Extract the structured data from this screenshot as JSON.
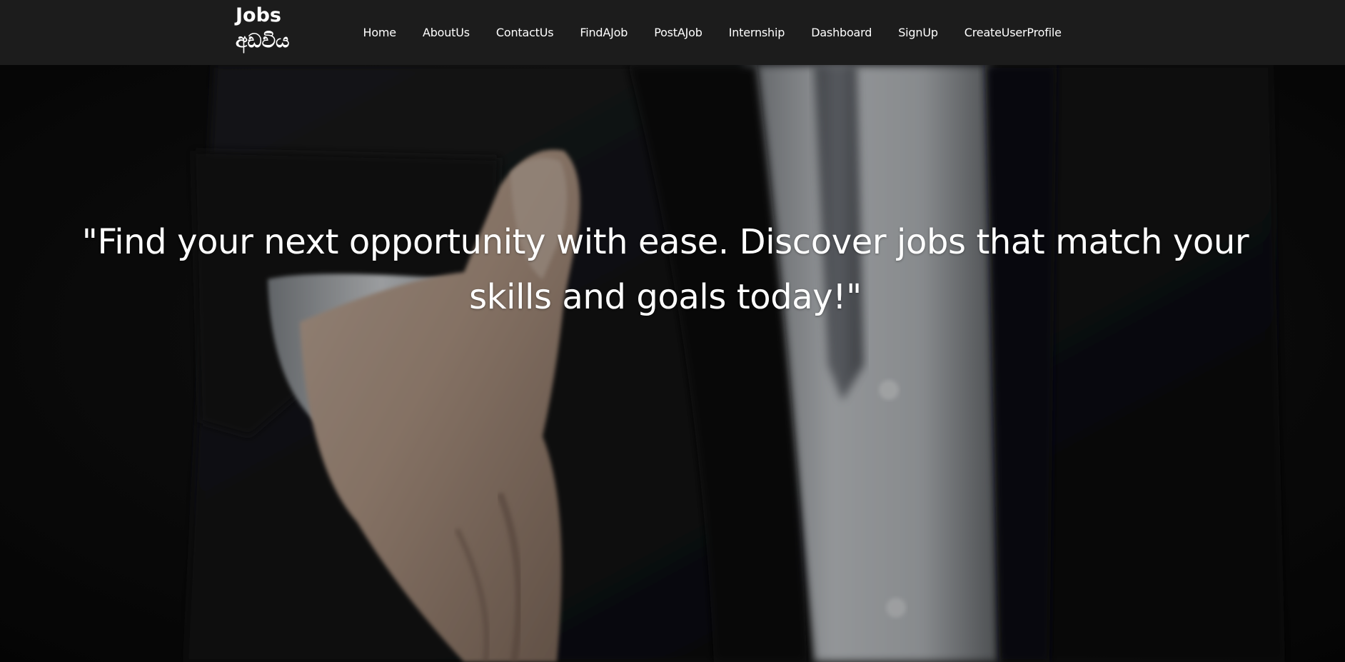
{
  "brand": {
    "line1": "Jobs",
    "line2": "අඩවිය"
  },
  "nav": {
    "items": [
      {
        "label": "Home"
      },
      {
        "label": "AboutUs"
      },
      {
        "label": "ContactUs"
      },
      {
        "label": "FindAJob"
      },
      {
        "label": "PostAJob"
      },
      {
        "label": "Internship"
      },
      {
        "label": "Dashboard"
      },
      {
        "label": "SignUp"
      },
      {
        "label": "CreateUserProfile"
      }
    ]
  },
  "hero": {
    "quote": "\"Find your next opportunity with ease. Discover jobs that match your skills and goals today!\""
  },
  "colors": {
    "navbar_bg": "#1c1c1c",
    "text": "#ffffff"
  }
}
